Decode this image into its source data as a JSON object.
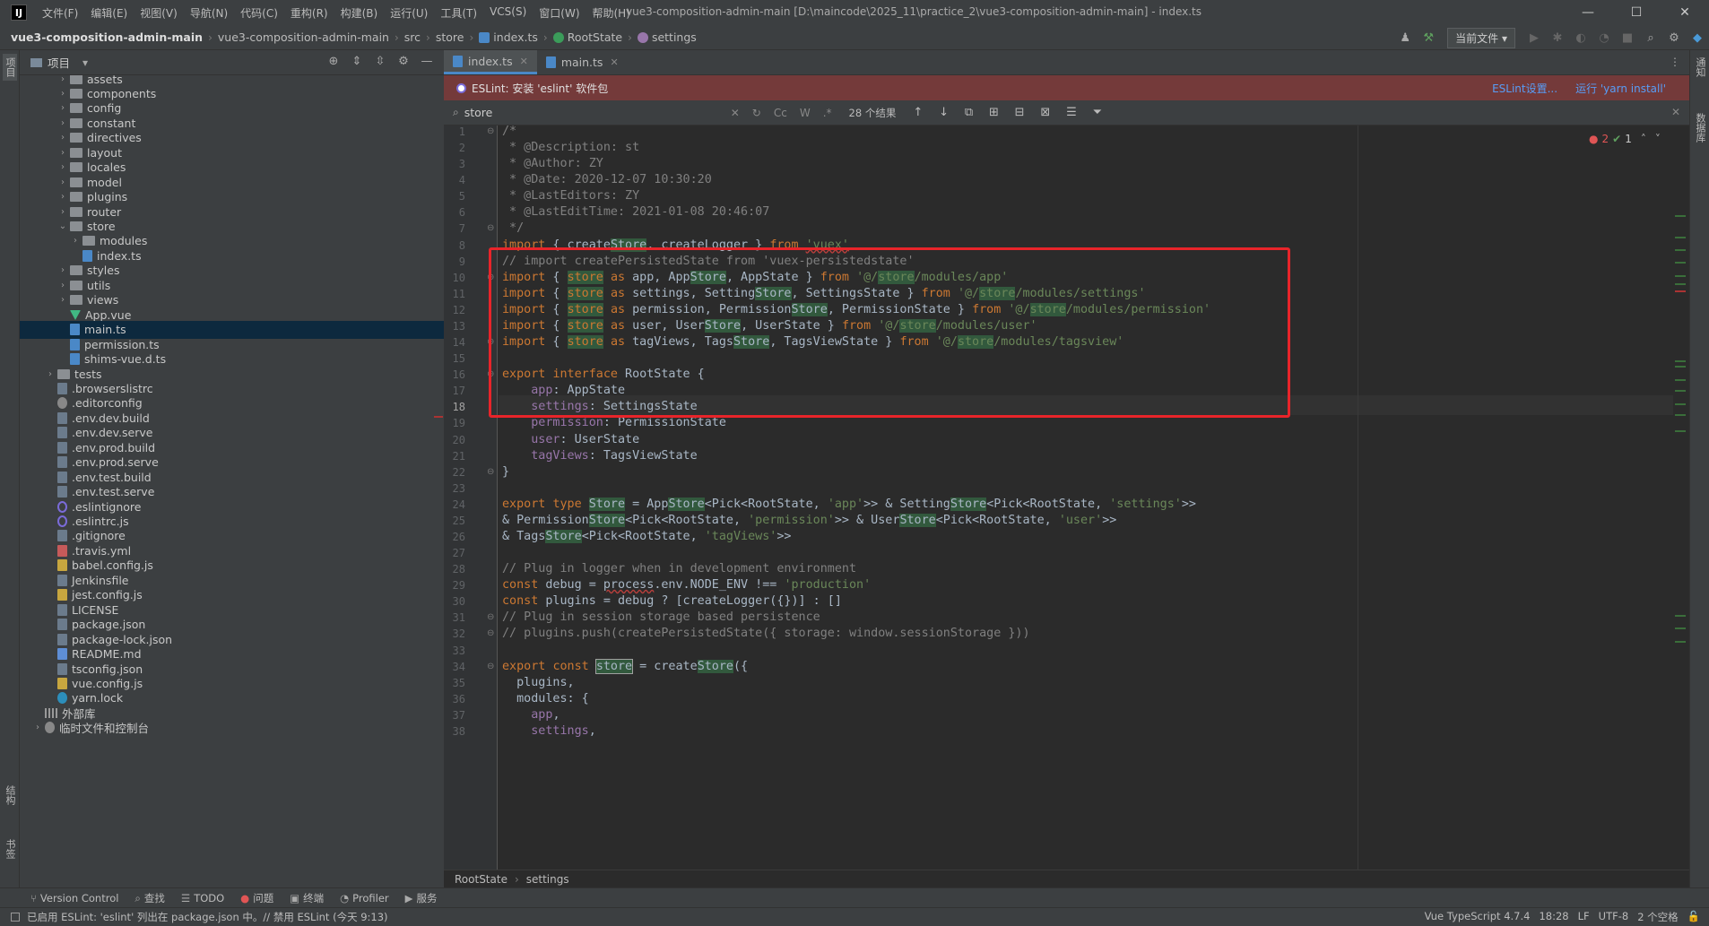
{
  "menubar": {
    "items": [
      "文件(F)",
      "编辑(E)",
      "视图(V)",
      "导航(N)",
      "代码(C)",
      "重构(R)",
      "构建(B)",
      "运行(U)",
      "工具(T)",
      "VCS(S)",
      "窗口(W)",
      "帮助(H)"
    ],
    "title": "vue3-composition-admin-main [D:\\maincode\\2025_11\\practice_2\\vue3-composition-admin-main] - index.ts"
  },
  "navbar": {
    "crumbs": [
      "vue3-composition-admin-main",
      "vue3-composition-admin-main",
      "src",
      "store",
      "index.ts",
      "RootState",
      "settings"
    ],
    "run_config": "当前文件"
  },
  "project": {
    "label": "项目"
  },
  "tree": [
    {
      "name": "assets",
      "type": "folder",
      "depth": 3,
      "arrow": "›"
    },
    {
      "name": "components",
      "type": "folder",
      "depth": 3,
      "arrow": "›"
    },
    {
      "name": "config",
      "type": "folder",
      "depth": 3,
      "arrow": "›"
    },
    {
      "name": "constant",
      "type": "folder",
      "depth": 3,
      "arrow": "›"
    },
    {
      "name": "directives",
      "type": "folder",
      "depth": 3,
      "arrow": "›"
    },
    {
      "name": "layout",
      "type": "folder",
      "depth": 3,
      "arrow": "›"
    },
    {
      "name": "locales",
      "type": "folder",
      "depth": 3,
      "arrow": "›"
    },
    {
      "name": "model",
      "type": "folder",
      "depth": 3,
      "arrow": "›"
    },
    {
      "name": "plugins",
      "type": "folder",
      "depth": 3,
      "arrow": "›"
    },
    {
      "name": "router",
      "type": "folder",
      "depth": 3,
      "arrow": "›"
    },
    {
      "name": "store",
      "type": "folder",
      "depth": 3,
      "arrow": "⌄"
    },
    {
      "name": "modules",
      "type": "folder",
      "depth": 4,
      "arrow": "›"
    },
    {
      "name": "index.ts",
      "type": "ts",
      "depth": 4,
      "arrow": ""
    },
    {
      "name": "styles",
      "type": "folder",
      "depth": 3,
      "arrow": "›"
    },
    {
      "name": "utils",
      "type": "folder",
      "depth": 3,
      "arrow": "›"
    },
    {
      "name": "views",
      "type": "folder",
      "depth": 3,
      "arrow": "›"
    },
    {
      "name": "App.vue",
      "type": "vue",
      "depth": 3,
      "arrow": ""
    },
    {
      "name": "main.ts",
      "type": "ts",
      "depth": 3,
      "arrow": "",
      "selected": true
    },
    {
      "name": "permission.ts",
      "type": "ts",
      "depth": 3,
      "arrow": ""
    },
    {
      "name": "shims-vue.d.ts",
      "type": "ts",
      "depth": 3,
      "arrow": ""
    },
    {
      "name": "tests",
      "type": "folder",
      "depth": 2,
      "arrow": "›"
    },
    {
      "name": ".browserslistrc",
      "type": "file",
      "depth": 2,
      "arrow": ""
    },
    {
      "name": ".editorconfig",
      "type": "cfg",
      "depth": 2,
      "arrow": ""
    },
    {
      "name": ".env.dev.build",
      "type": "file",
      "depth": 2,
      "arrow": ""
    },
    {
      "name": ".env.dev.serve",
      "type": "file",
      "depth": 2,
      "arrow": ""
    },
    {
      "name": ".env.prod.build",
      "type": "file",
      "depth": 2,
      "arrow": ""
    },
    {
      "name": ".env.prod.serve",
      "type": "file",
      "depth": 2,
      "arrow": ""
    },
    {
      "name": ".env.test.build",
      "type": "file",
      "depth": 2,
      "arrow": ""
    },
    {
      "name": ".env.test.serve",
      "type": "file",
      "depth": 2,
      "arrow": ""
    },
    {
      "name": ".eslintignore",
      "type": "rnd",
      "depth": 2,
      "arrow": ""
    },
    {
      "name": ".eslintrc.js",
      "type": "rnd",
      "depth": 2,
      "arrow": ""
    },
    {
      "name": ".gitignore",
      "type": "file",
      "depth": 2,
      "arrow": ""
    },
    {
      "name": ".travis.yml",
      "type": "yml",
      "depth": 2,
      "arrow": ""
    },
    {
      "name": "babel.config.js",
      "type": "js",
      "depth": 2,
      "arrow": ""
    },
    {
      "name": "Jenkinsfile",
      "type": "file",
      "depth": 2,
      "arrow": ""
    },
    {
      "name": "jest.config.js",
      "type": "js",
      "depth": 2,
      "arrow": ""
    },
    {
      "name": "LICENSE",
      "type": "file",
      "depth": 2,
      "arrow": ""
    },
    {
      "name": "package.json",
      "type": "file",
      "depth": 2,
      "arrow": ""
    },
    {
      "name": "package-lock.json",
      "type": "file",
      "depth": 2,
      "arrow": ""
    },
    {
      "name": "README.md",
      "type": "md",
      "depth": 2,
      "arrow": ""
    },
    {
      "name": "tsconfig.json",
      "type": "file",
      "depth": 2,
      "arrow": ""
    },
    {
      "name": "vue.config.js",
      "type": "js",
      "depth": 2,
      "arrow": ""
    },
    {
      "name": "yarn.lock",
      "type": "yarn",
      "depth": 2,
      "arrow": ""
    },
    {
      "name": "外部库",
      "type": "lib",
      "depth": 1,
      "arrow": ""
    },
    {
      "name": "临时文件和控制台",
      "type": "cfg",
      "depth": 1,
      "arrow": "›"
    }
  ],
  "tabs": [
    {
      "label": "index.ts",
      "active": true
    },
    {
      "label": "main.ts",
      "active": false
    }
  ],
  "eslint_banner": {
    "text": "ESLint: 安装 'eslint' 软件包",
    "link1": "ESLint设置...",
    "link2": "运行 'yarn install'"
  },
  "search": {
    "value": "store",
    "cc": "Cc",
    "w": "W",
    "regex": ".*",
    "count": "28 个结果"
  },
  "inspections": {
    "errors": "2",
    "warnings": "1"
  },
  "code": {
    "current_line": 18,
    "lines": [
      [
        [
          "c",
          "/*"
        ]
      ],
      [
        [
          "c",
          " * @Description: st"
        ]
      ],
      [
        [
          "c",
          " * @Author: ZY"
        ]
      ],
      [
        [
          "c",
          " * @Date: 2020-12-07 10:30:20"
        ]
      ],
      [
        [
          "c",
          " * @LastEditors: ZY"
        ]
      ],
      [
        [
          "c",
          " * @LastEditTime: 2021-01-08 20:46:07"
        ]
      ],
      [
        [
          "c",
          " */"
        ]
      ],
      [
        [
          "k",
          "import"
        ],
        [
          "n",
          " { create"
        ],
        [
          "h",
          "Store"
        ],
        [
          "n",
          ", createLogger } "
        ],
        [
          "k",
          "from"
        ],
        [
          "n",
          " "
        ],
        [
          "su",
          "'vuex'"
        ]
      ],
      [
        [
          "c",
          "// import createPersistedState from 'vuex-persistedstate'"
        ]
      ],
      [
        [
          "k",
          "import"
        ],
        [
          "n",
          " { "
        ],
        [
          "hk",
          "store"
        ],
        [
          "n",
          " "
        ],
        [
          "k",
          "as"
        ],
        [
          "n",
          " app, App"
        ],
        [
          "h",
          "Store"
        ],
        [
          "n",
          ", AppState } "
        ],
        [
          "k",
          "from"
        ],
        [
          "n",
          " "
        ],
        [
          "s",
          "'@/"
        ],
        [
          "hs",
          "store"
        ],
        [
          "s",
          "/modules/app'"
        ]
      ],
      [
        [
          "k",
          "import"
        ],
        [
          "n",
          " { "
        ],
        [
          "hk",
          "store"
        ],
        [
          "n",
          " "
        ],
        [
          "k",
          "as"
        ],
        [
          "n",
          " settings, Setting"
        ],
        [
          "h",
          "Store"
        ],
        [
          "n",
          ", SettingsState } "
        ],
        [
          "k",
          "from"
        ],
        [
          "n",
          " "
        ],
        [
          "s",
          "'@/"
        ],
        [
          "hs",
          "store"
        ],
        [
          "s",
          "/modules/settings'"
        ]
      ],
      [
        [
          "k",
          "import"
        ],
        [
          "n",
          " { "
        ],
        [
          "hk",
          "store"
        ],
        [
          "n",
          " "
        ],
        [
          "k",
          "as"
        ],
        [
          "n",
          " permission, Permission"
        ],
        [
          "h",
          "Store"
        ],
        [
          "n",
          ", PermissionState } "
        ],
        [
          "k",
          "from"
        ],
        [
          "n",
          " "
        ],
        [
          "s",
          "'@/"
        ],
        [
          "hs",
          "store"
        ],
        [
          "s",
          "/modules/permission'"
        ]
      ],
      [
        [
          "k",
          "import"
        ],
        [
          "n",
          " { "
        ],
        [
          "hk",
          "store"
        ],
        [
          "n",
          " "
        ],
        [
          "k",
          "as"
        ],
        [
          "n",
          " user, User"
        ],
        [
          "h",
          "Store"
        ],
        [
          "n",
          ", UserState } "
        ],
        [
          "k",
          "from"
        ],
        [
          "n",
          " "
        ],
        [
          "s",
          "'@/"
        ],
        [
          "hs",
          "store"
        ],
        [
          "s",
          "/modules/user'"
        ]
      ],
      [
        [
          "k",
          "import"
        ],
        [
          "n",
          " { "
        ],
        [
          "hk",
          "store"
        ],
        [
          "n",
          " "
        ],
        [
          "k",
          "as"
        ],
        [
          "n",
          " tagViews, Tags"
        ],
        [
          "h",
          "Store"
        ],
        [
          "n",
          ", TagsViewState } "
        ],
        [
          "k",
          "from"
        ],
        [
          "n",
          " "
        ],
        [
          "s",
          "'@/"
        ],
        [
          "hs",
          "store"
        ],
        [
          "s",
          "/modules/tagsview'"
        ]
      ],
      [],
      [
        [
          "k",
          "export"
        ],
        [
          "n",
          " "
        ],
        [
          "k",
          "interface"
        ],
        [
          "n",
          " RootState {"
        ]
      ],
      [
        [
          "n",
          "    "
        ],
        [
          "p",
          "app"
        ],
        [
          "n",
          ": AppState"
        ]
      ],
      [
        [
          "n",
          "    "
        ],
        [
          "p",
          "settings"
        ],
        [
          "n",
          ": SettingsState"
        ]
      ],
      [
        [
          "n",
          "    "
        ],
        [
          "p",
          "permission"
        ],
        [
          "n",
          ": PermissionState"
        ]
      ],
      [
        [
          "n",
          "    "
        ],
        [
          "p",
          "user"
        ],
        [
          "n",
          ": UserState"
        ]
      ],
      [
        [
          "n",
          "    "
        ],
        [
          "p",
          "tagViews"
        ],
        [
          "n",
          ": TagsViewState"
        ]
      ],
      [
        [
          "n",
          "}"
        ]
      ],
      [],
      [
        [
          "k",
          "export"
        ],
        [
          "n",
          " "
        ],
        [
          "k",
          "type"
        ],
        [
          "n",
          " "
        ],
        [
          "h",
          "Store"
        ],
        [
          "n",
          " = App"
        ],
        [
          "h",
          "Store"
        ],
        [
          "n",
          "<Pick<RootState, "
        ],
        [
          "s",
          "'app'"
        ],
        [
          "n",
          ">> & Setting"
        ],
        [
          "h",
          "Store"
        ],
        [
          "n",
          "<Pick<RootState, "
        ],
        [
          "s",
          "'settings'"
        ],
        [
          "n",
          ">>"
        ]
      ],
      [
        [
          "n",
          "& Permission"
        ],
        [
          "h",
          "Store"
        ],
        [
          "n",
          "<Pick<RootState, "
        ],
        [
          "s",
          "'permission'"
        ],
        [
          "n",
          ">> & User"
        ],
        [
          "h",
          "Store"
        ],
        [
          "n",
          "<Pick<RootState, "
        ],
        [
          "s",
          "'user'"
        ],
        [
          "n",
          ">>"
        ]
      ],
      [
        [
          "n",
          "& Tags"
        ],
        [
          "h",
          "Store"
        ],
        [
          "n",
          "<Pick<RootState, "
        ],
        [
          "s",
          "'tagViews'"
        ],
        [
          "n",
          ">>"
        ]
      ],
      [],
      [
        [
          "c",
          "// Plug in logger when in development environment"
        ]
      ],
      [
        [
          "k",
          "const"
        ],
        [
          "n",
          " debug = "
        ],
        [
          "nu",
          "process"
        ],
        [
          "n",
          ".env.NODE_ENV !== "
        ],
        [
          "s",
          "'production'"
        ]
      ],
      [
        [
          "k",
          "const"
        ],
        [
          "n",
          " plugins = debug ? [createLogger({})] : []"
        ]
      ],
      [
        [
          "c",
          "// Plug in session storage based persistence"
        ]
      ],
      [
        [
          "c",
          "// plugins.push(createPersistedState({ storage: window.sessionStorage }))"
        ]
      ],
      [],
      [
        [
          "k",
          "export"
        ],
        [
          "n",
          " "
        ],
        [
          "k",
          "const"
        ],
        [
          "n",
          " "
        ],
        [
          "hb",
          "store"
        ],
        [
          "n",
          " = create"
        ],
        [
          "h",
          "Store"
        ],
        [
          "n",
          "({"
        ]
      ],
      [
        [
          "n",
          "  plugins,"
        ]
      ],
      [
        [
          "n",
          "  modules: {"
        ]
      ],
      [
        [
          "n",
          "    "
        ],
        [
          "p",
          "app"
        ],
        [
          "n",
          ","
        ]
      ],
      [
        [
          "n",
          "    "
        ],
        [
          "p",
          "settings"
        ],
        [
          "n",
          ","
        ]
      ]
    ]
  },
  "breadcrumb": {
    "a": "RootState",
    "b": "settings"
  },
  "toolwindows": [
    "Version Control",
    "查找",
    "TODO",
    "问题",
    "终端",
    "Profiler",
    "服务"
  ],
  "status": {
    "message": "已启用 ESLint: 'eslint' 列出在 package.json 中。// 禁用 ESLint (今天 9:13)",
    "lang": "Vue TypeScript 4.7.4",
    "pos": "18:28",
    "eol": "LF",
    "enc": "UTF-8",
    "indent": "2 个空格"
  },
  "strips": {
    "left_top": "项目",
    "left_mid": "结构",
    "left_bot": "书签",
    "right_top": "通知",
    "right_mid": "数据库"
  }
}
